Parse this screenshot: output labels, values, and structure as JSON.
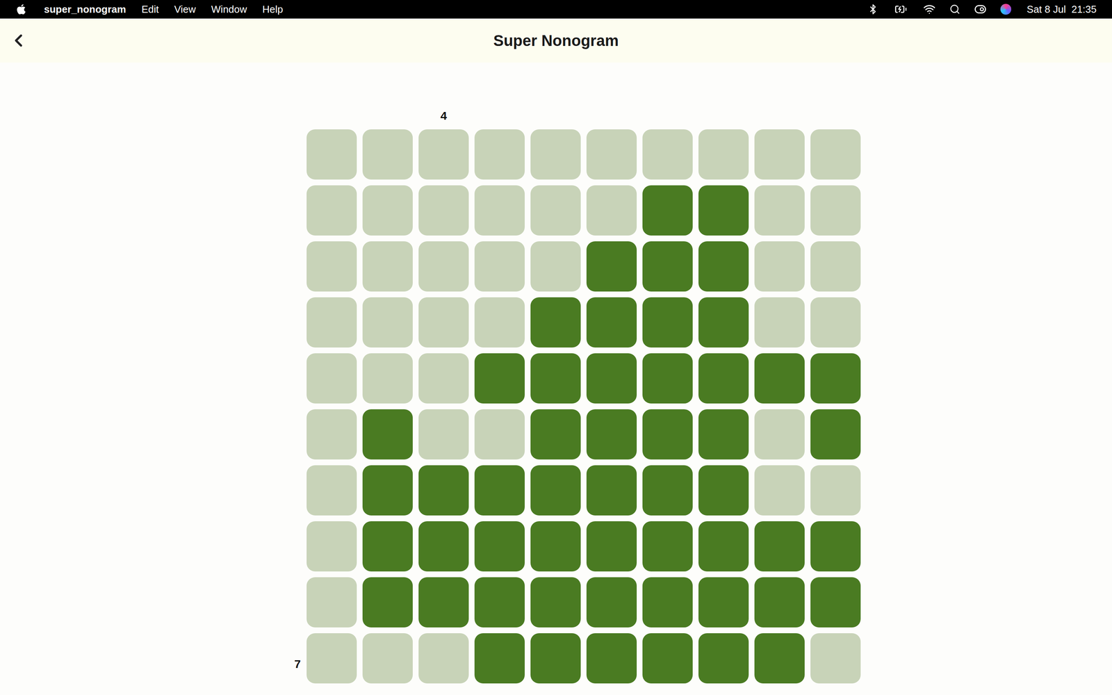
{
  "menu_bar": {
    "app_name": "super_nonogram",
    "menus": [
      "Edit",
      "View",
      "Window",
      "Help"
    ],
    "clock": "Sat 8 Jul  21:35"
  },
  "header": {
    "title": "Super Nonogram"
  },
  "grid": {
    "column_clues": [
      "",
      "",
      "4",
      "",
      "",
      "",
      "",
      "",
      "",
      ""
    ],
    "row_clues": [
      "",
      "",
      "",
      "",
      "",
      "",
      "",
      "",
      "",
      "7"
    ],
    "rows": [
      [
        false,
        false,
        false,
        false,
        false,
        false,
        false,
        false,
        false,
        false
      ],
      [
        false,
        false,
        false,
        false,
        false,
        false,
        true,
        true,
        false,
        false
      ],
      [
        false,
        false,
        false,
        false,
        false,
        true,
        true,
        true,
        false,
        false
      ],
      [
        false,
        false,
        false,
        false,
        true,
        true,
        true,
        true,
        false,
        false
      ],
      [
        false,
        false,
        false,
        true,
        true,
        true,
        true,
        true,
        true,
        true
      ],
      [
        false,
        true,
        false,
        false,
        true,
        true,
        true,
        true,
        false,
        true
      ],
      [
        false,
        true,
        true,
        true,
        true,
        true,
        true,
        true,
        false,
        false
      ],
      [
        false,
        true,
        true,
        true,
        true,
        true,
        true,
        true,
        true,
        true
      ],
      [
        false,
        true,
        true,
        true,
        true,
        true,
        true,
        true,
        true,
        true
      ],
      [
        false,
        false,
        false,
        true,
        true,
        true,
        true,
        true,
        true,
        false
      ]
    ]
  }
}
